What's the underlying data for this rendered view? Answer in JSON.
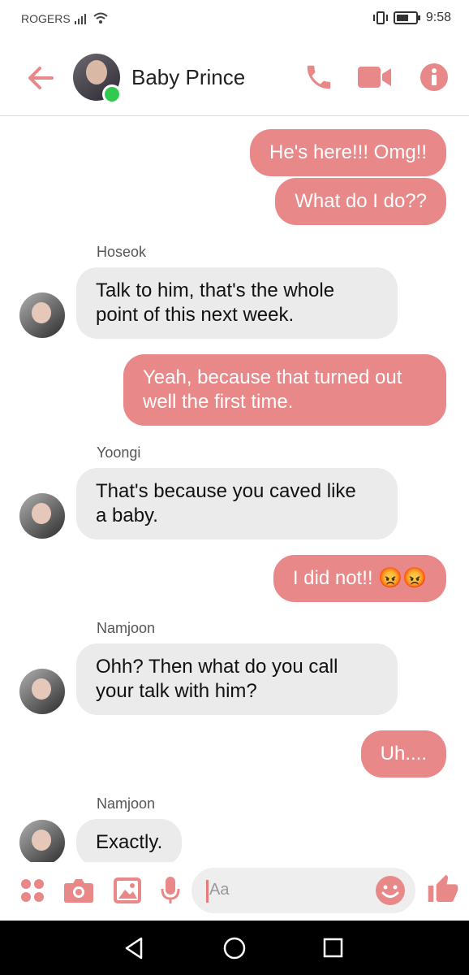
{
  "status": {
    "carrier": "ROGERS",
    "time": "9:58"
  },
  "header": {
    "title": "Baby Prince"
  },
  "composer": {
    "placeholder": "Aa"
  },
  "messages": [
    {
      "sender": "",
      "text": "He's here!!! Omg!!",
      "mine": true
    },
    {
      "sender": "",
      "text": "What do I do??",
      "mine": true
    },
    {
      "sender": "Hoseok",
      "text": "Talk to him, that's the whole\npoint of this next week.",
      "mine": false
    },
    {
      "sender": "",
      "text": "Yeah, because that turned out\nwell the first time.",
      "mine": true
    },
    {
      "sender": "Yoongi",
      "text": "That's because you caved like\na baby.",
      "mine": false
    },
    {
      "sender": "",
      "text": "I did not!! 😡😡",
      "mine": true
    },
    {
      "sender": "Namjoon",
      "text": "Ohh? Then what do you call\nyour talk with him?",
      "mine": false
    },
    {
      "sender": "",
      "text": "Uh....",
      "mine": true
    },
    {
      "sender": "Namjoon",
      "text": "Exactly.",
      "mine": false
    }
  ],
  "colors": {
    "accent": "#e88888",
    "online": "#31c950",
    "their_bubble": "#ebebeb"
  }
}
